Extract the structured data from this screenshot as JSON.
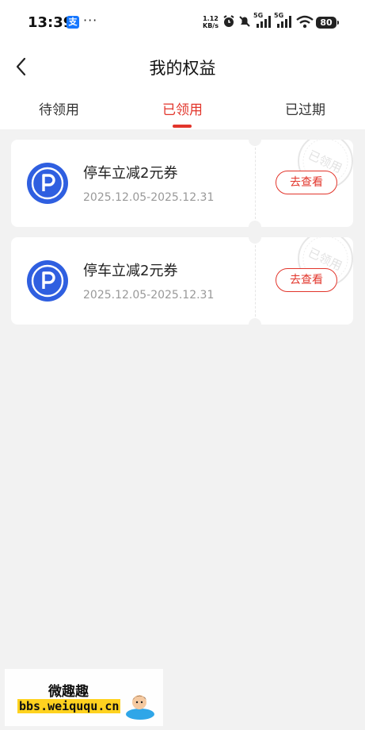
{
  "status_bar": {
    "time": "13:39",
    "alipay_glyph": "支",
    "more": "···",
    "net_speed_value": "1.12",
    "net_speed_unit": "KB/s",
    "sim1": "5G",
    "sim2": "5G",
    "battery": "80"
  },
  "header": {
    "title": "我的权益"
  },
  "tabs": [
    {
      "label": "待领用"
    },
    {
      "label": "已领用",
      "active": true
    },
    {
      "label": "已过期"
    }
  ],
  "coupons": [
    {
      "name": "停车立减2元券",
      "date_range": "2025.12.05-2025.12.31",
      "button": "去查看",
      "stamp": "已领用"
    },
    {
      "name": "停车立减2元券",
      "date_range": "2025.12.05-2025.12.31",
      "button": "去查看",
      "stamp": "已领用"
    }
  ],
  "watermark": {
    "title": "微趣趣",
    "url": "bbs.weiququ.cn"
  },
  "colors": {
    "accent": "#e2352b",
    "icon_blue": "#2f5fe0",
    "background": "#f2f2f2"
  }
}
